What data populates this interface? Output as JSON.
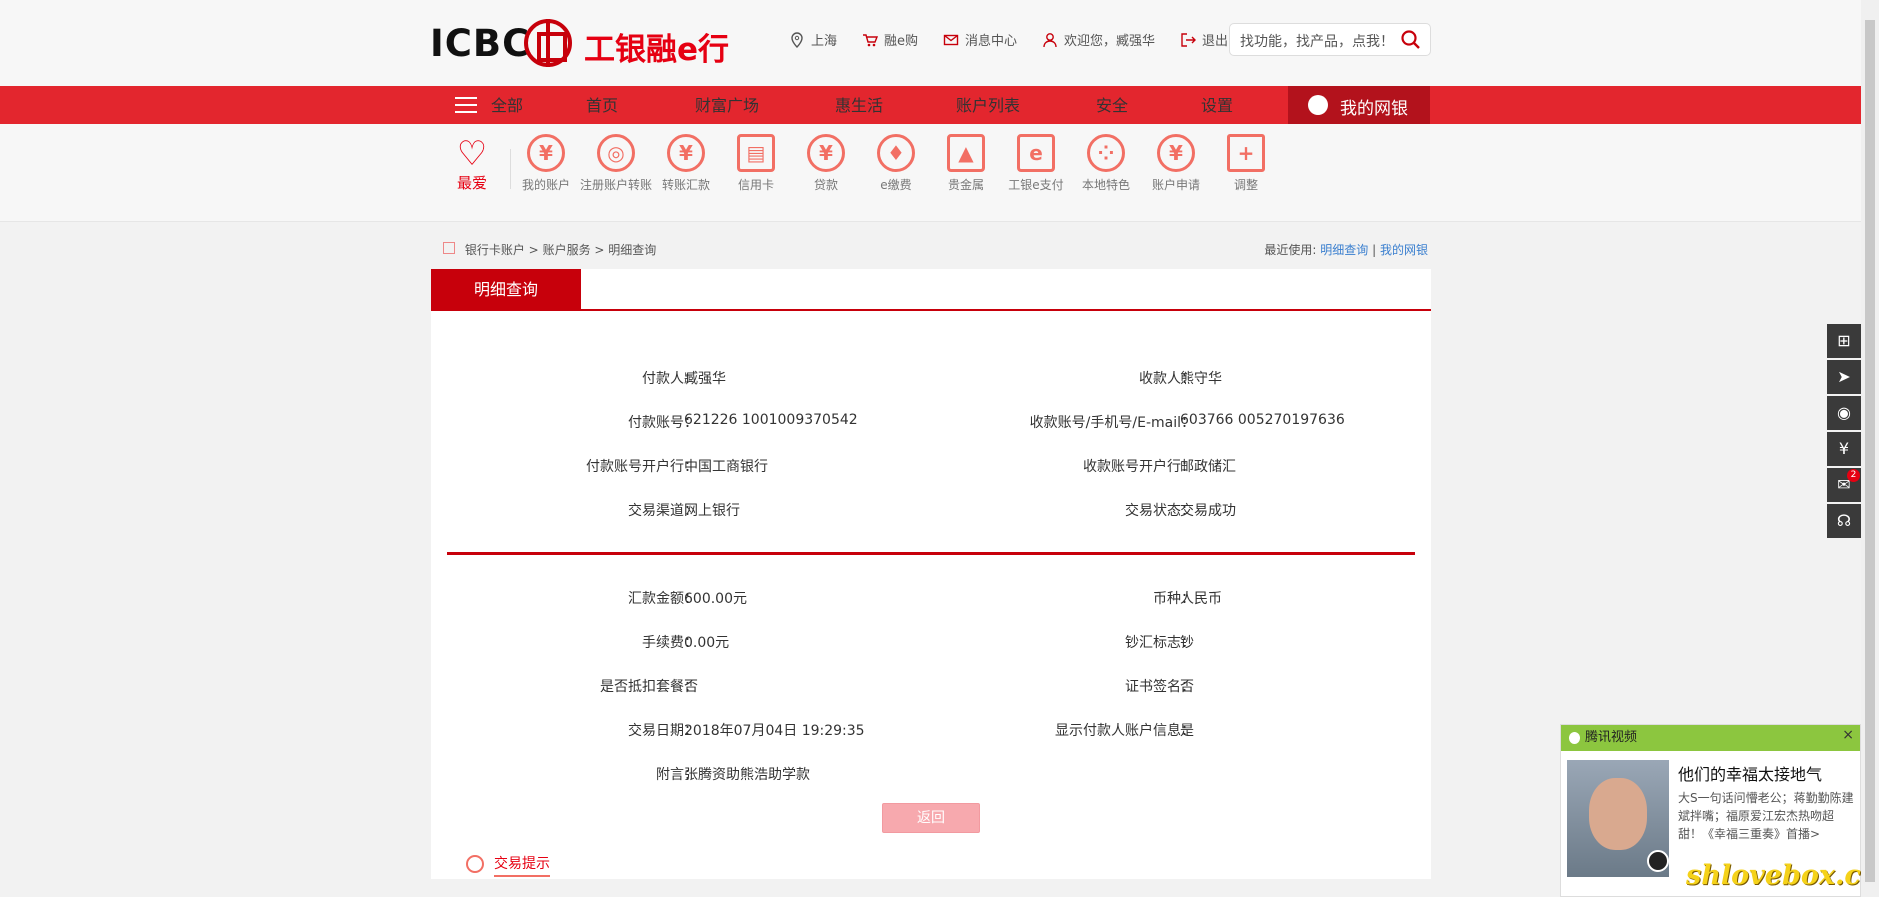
{
  "header": {
    "logo_text": "ICBC",
    "logo_cn": "工银融e行",
    "links": {
      "city": "上海",
      "shop": "融e购",
      "messages": "消息中心",
      "welcome": "欢迎您，臧强华",
      "logout": "退出"
    },
    "search_placeholder": "找功能，找产品，点我！"
  },
  "nav": {
    "all": "全部",
    "items": [
      "首页",
      "财富广场",
      "惠生活",
      "账户列表",
      "安全",
      "设置"
    ],
    "mybank": "我的网银"
  },
  "favorites": {
    "title": "最爱",
    "items": [
      "我的账户",
      "注册账户转账",
      "转账汇款",
      "信用卡",
      "贷款",
      "e缴费",
      "贵金属",
      "工银e支付",
      "本地特色",
      "账户申请",
      "调整"
    ]
  },
  "breadcrumb": {
    "items": [
      "银行卡账户",
      "账户服务",
      "明细查询"
    ],
    "sep": ">",
    "recent_label": "最近使用:",
    "recent_links": [
      "明细查询",
      "我的网银"
    ],
    "recent_sep": "|"
  },
  "panel": {
    "tab": "明细查询",
    "rows_top": [
      {
        "l_label": "付款人：",
        "l_value": "臧强华",
        "r_label": "收款人：",
        "r_value": "熊守华"
      },
      {
        "l_label": "付款账号：",
        "l_value": "621226 1001009370542",
        "r_label": "收款账号/手机号/E-mail：",
        "r_value": "603766 005270197636"
      },
      {
        "l_label": "付款账号开户行：",
        "l_value": "中国工商银行",
        "r_label": "收款账号开户行：",
        "r_value": "邮政储汇"
      },
      {
        "l_label": "交易渠道：",
        "l_value": "网上银行",
        "r_label": "交易状态：",
        "r_value": "交易成功"
      }
    ],
    "rows_bottom": [
      {
        "l_label": "汇款金额：",
        "l_value": "600.00元",
        "r_label": "币种：",
        "r_value": "人民币"
      },
      {
        "l_label": "手续费：",
        "l_value": "0.00元",
        "r_label": "钞汇标志：",
        "r_value": "钞"
      },
      {
        "l_label": "是否抵扣套餐：",
        "l_value": "否",
        "r_label": "证书签名：",
        "r_value": "否"
      },
      {
        "l_label": "交易日期：",
        "l_value": "2018年07月04日 19:29:35",
        "r_label": "显示付款人账户信息：",
        "r_value": "是"
      },
      {
        "l_label": "附言：",
        "l_value": "张腾资助熊浩助学款",
        "r_label": "",
        "r_value": ""
      }
    ],
    "back": "返回",
    "tips": "交易提示"
  },
  "toolbar": {
    "badge": "2"
  },
  "video": {
    "brand": "腾讯视频",
    "close": "×",
    "title": "他们的幸福太接地气",
    "desc": "大S一句话问懵老公；蒋勤勤陈建斌拌嘴；福原爱江宏杰热吻超甜！《幸福三重奏》首播>"
  },
  "watermark": "shlovebox.com"
}
